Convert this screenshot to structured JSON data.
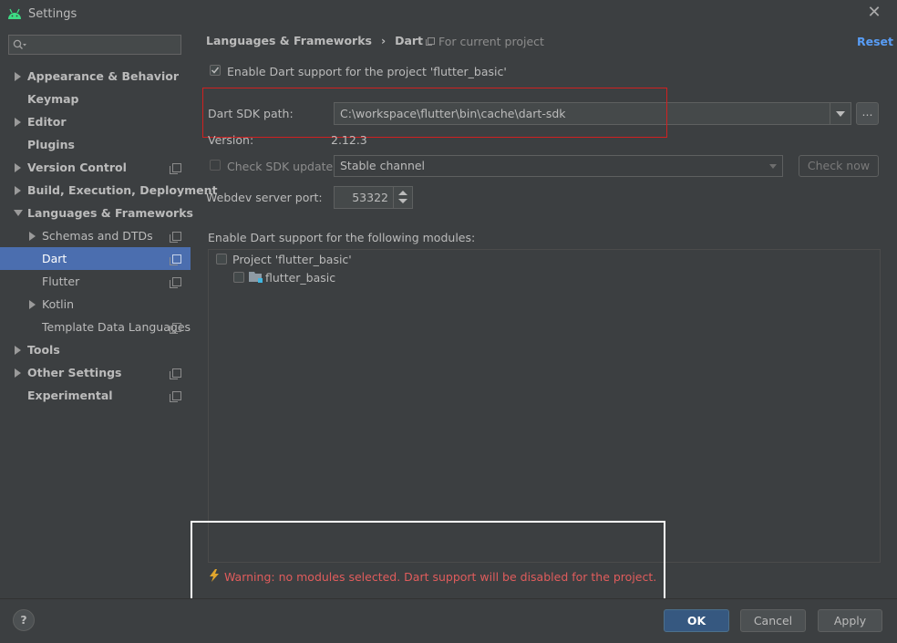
{
  "window": {
    "title": "Settings"
  },
  "search": {
    "placeholder": ""
  },
  "sidebar": {
    "items": [
      {
        "label": "Appearance & Behavior"
      },
      {
        "label": "Keymap"
      },
      {
        "label": "Editor"
      },
      {
        "label": "Plugins"
      },
      {
        "label": "Version Control"
      },
      {
        "label": "Build, Execution, Deployment"
      },
      {
        "label": "Languages & Frameworks"
      },
      {
        "label": "Schemas and DTDs"
      },
      {
        "label": "Dart"
      },
      {
        "label": "Flutter"
      },
      {
        "label": "Kotlin"
      },
      {
        "label": "Template Data Languages"
      },
      {
        "label": "Tools"
      },
      {
        "label": "Other Settings"
      },
      {
        "label": "Experimental"
      }
    ]
  },
  "header": {
    "breadcrumb_parent": "Languages & Frameworks",
    "breadcrumb_sep": "›",
    "breadcrumb_current": "Dart",
    "scope": "For current project",
    "reset": "Reset"
  },
  "main": {
    "enable_label": "Enable Dart support for the project 'flutter_basic'",
    "sdk_path_label": "Dart SDK path:",
    "sdk_path_value": "C:\\workspace\\flutter\\bin\\cache\\dart-sdk",
    "browse_label": "...",
    "version_label": "Version:",
    "version_value": "2.12.3",
    "check_update_label": "Check SDK update:",
    "channel_value": "Stable channel",
    "check_now_label": "Check now",
    "webdev_label": "Webdev server port:",
    "webdev_value": "53322",
    "modules_label": "Enable Dart support for the following modules:",
    "modules": [
      {
        "label": "Project 'flutter_basic'"
      },
      {
        "label": "flutter_basic"
      }
    ],
    "warning": "Warning: no modules selected. Dart support will be disabled for the project."
  },
  "footer": {
    "help": "?",
    "ok": "OK",
    "cancel": "Cancel",
    "apply": "Apply"
  },
  "colors": {
    "background": "#3c3f41",
    "selection": "#4b6eaf",
    "link": "#589df6",
    "warning": "#e05c5c",
    "highlight_red": "#d02020",
    "highlight_white": "#ffffff"
  }
}
